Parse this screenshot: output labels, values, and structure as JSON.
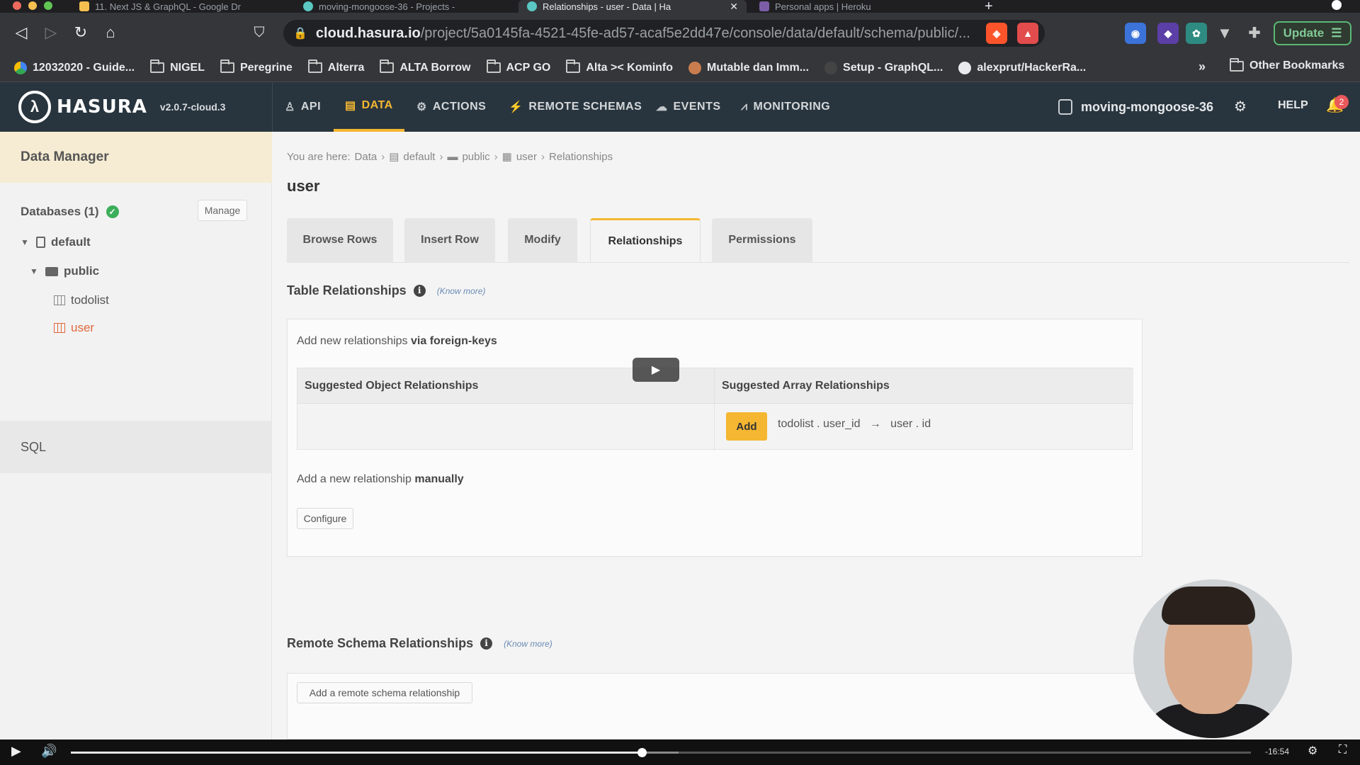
{
  "browser": {
    "tabs": [
      {
        "title": "11. Next JS & GraphQL - Google Dr",
        "active": false
      },
      {
        "title": "moving-mongoose-36 - Projects -",
        "active": false
      },
      {
        "title": "Relationships - user - Data | Ha",
        "active": true
      },
      {
        "title": "Personal apps | Heroku",
        "active": false
      }
    ],
    "url_host": "cloud.hasura.io",
    "url_path": "/project/5a0145fa-4521-45fe-ad57-acaf5e2dd47e/console/data/default/schema/public/...",
    "update_label": "Update",
    "bookmarks": [
      "12032020 - Guide...",
      "NIGEL",
      "Peregrine",
      "Alterra",
      "ALTA Borrow",
      "ACP GO",
      "Alta >< Kominfo",
      "Mutable dan Imm...",
      "Setup - GraphQL...",
      "alexprut/HackerRa..."
    ],
    "bookmarks_more": "»",
    "other_bookmarks": "Other Bookmarks"
  },
  "app": {
    "brand": "HASURA",
    "version": "v2.0.7-cloud.3",
    "nav": [
      {
        "label": "API",
        "icon": "api-icon",
        "glyph": "♙"
      },
      {
        "label": "DATA",
        "icon": "database-icon",
        "glyph": "▤",
        "active": true
      },
      {
        "label": "ACTIONS",
        "icon": "gears-icon",
        "glyph": "⚙"
      },
      {
        "label": "REMOTE SCHEMAS",
        "icon": "plug-icon",
        "glyph": "⚡"
      },
      {
        "label": "EVENTS",
        "icon": "cloud-icon",
        "glyph": "☁"
      },
      {
        "label": "MONITORING",
        "icon": "chart-icon",
        "glyph": "📈"
      }
    ],
    "project_name": "moving-mongoose-36",
    "help_label": "HELP",
    "notification_count": "2"
  },
  "sidebar": {
    "title": "Data Manager",
    "databases_label": "Databases (1)",
    "manage_label": "Manage",
    "tree": {
      "database": "default",
      "schema": "public",
      "tables": [
        "todolist",
        "user"
      ],
      "selected_table": "user"
    },
    "sql_label": "SQL"
  },
  "main": {
    "breadcrumb": {
      "prefix": "You are here:",
      "items": [
        "Data",
        "default",
        "public",
        "user",
        "Relationships"
      ]
    },
    "title": "user",
    "tabs": [
      "Browse Rows",
      "Insert Row",
      "Modify",
      "Relationships",
      "Permissions"
    ],
    "active_tab": "Relationships",
    "table_relationships": {
      "heading": "Table Relationships",
      "know_more": "(Know more)",
      "fk_prefix": "Add new relationships",
      "fk_emphasis": "via foreign-keys",
      "suggested_object_header": "Suggested Object Relationships",
      "suggested_array_header": "Suggested Array Relationships",
      "add_label": "Add",
      "suggested_array_relationship": "todolist . user_id   →   user . id",
      "manual_prefix": "Add a new relationship",
      "manual_emphasis": "manually",
      "configure_label": "Configure"
    },
    "remote_schema_relationships": {
      "heading": "Remote Schema Relationships",
      "know_more": "(Know more)",
      "add_label": "Add a remote schema relationship"
    }
  },
  "player": {
    "time_remaining": "-16:54",
    "progress_fraction": 0.484,
    "buffered_fraction": 0.515
  },
  "colors": {
    "accent": "#f5b731",
    "topnav_bg": "#29353e",
    "selected_table": "#e0683b",
    "success": "#3cae5a"
  }
}
